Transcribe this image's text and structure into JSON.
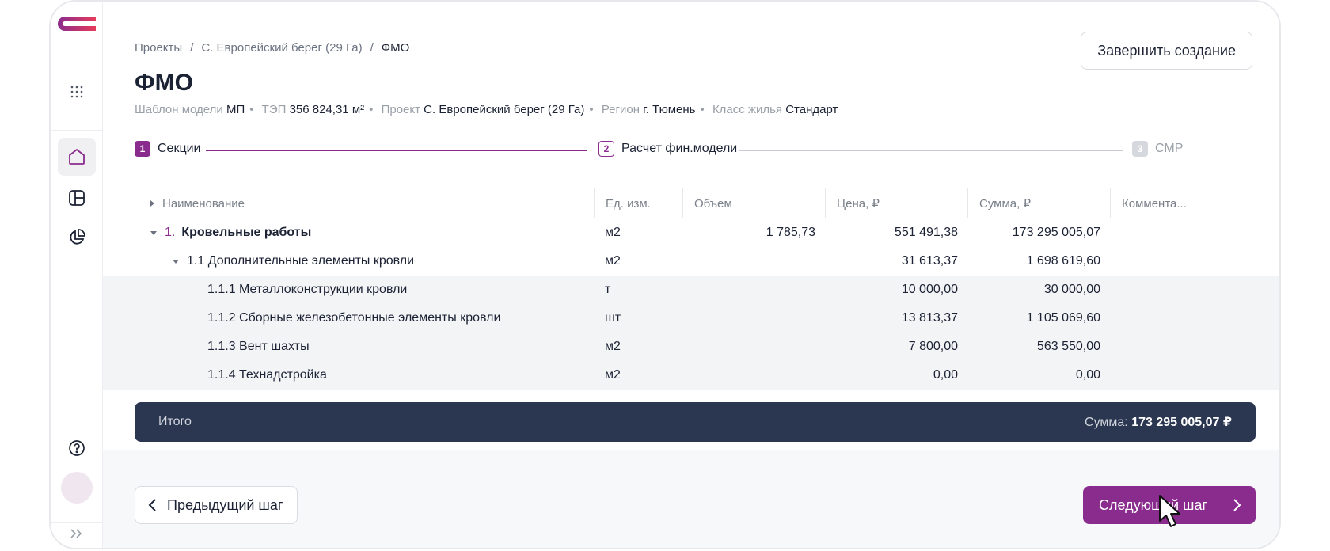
{
  "breadcrumb": [
    "Проекты",
    "С. Европейский берег (29 Га)",
    "ФМО"
  ],
  "breadcrumb_sep": "/",
  "finish_button": "Завершить создание",
  "page_title": "ФМО",
  "meta": [
    {
      "label": "Шаблон модели",
      "value": "МП"
    },
    {
      "label": "ТЭП",
      "value": "356 824,31 м²"
    },
    {
      "label": "Проект",
      "value": "С. Европейский берег (29 Га)"
    },
    {
      "label": "Регион",
      "value": "г. Тюмень"
    },
    {
      "label": "Класс жилья",
      "value": "Стандарт"
    }
  ],
  "steps": [
    {
      "num": "1",
      "label": "Секции",
      "state": "done"
    },
    {
      "num": "2",
      "label": "Расчет фин.модели",
      "state": "current"
    },
    {
      "num": "3",
      "label": "СМР",
      "state": "upcoming"
    }
  ],
  "table": {
    "columns": [
      "Наименование",
      "Ед. изм.",
      "Объем",
      "Цена, ₽",
      "Сумма, ₽",
      "Коммента..."
    ],
    "rows": [
      {
        "num": "1.",
        "name": "Кровельные работы",
        "unit": "м2",
        "volume": "1 785,73",
        "price": "551 491,38",
        "sum": "173 295 005,07",
        "level": 0
      },
      {
        "num": "",
        "name": "1.1 Дополнительные элементы кровли",
        "unit": "м2",
        "volume": "",
        "price": "31 613,37",
        "sum": "1 698 619,60",
        "level": 1
      },
      {
        "num": "",
        "name": "1.1.1 Металлоконструкции кровли",
        "unit": "т",
        "volume": "",
        "price": "10 000,00",
        "sum": "30 000,00",
        "level": 2
      },
      {
        "num": "",
        "name": "1.1.2 Сборные железобетонные элементы кровли",
        "unit": "шт",
        "volume": "",
        "price": "13 813,37",
        "sum": "1 105 069,60",
        "level": 2
      },
      {
        "num": "",
        "name": "1.1.3 Вент шахты",
        "unit": "м2",
        "volume": "",
        "price": "7 800,00",
        "sum": "563 550,00",
        "level": 2
      },
      {
        "num": "",
        "name": "1.1.4 Технадстройка",
        "unit": "м2",
        "volume": "",
        "price": "0,00",
        "sum": "0,00",
        "level": 2
      }
    ]
  },
  "total": {
    "label": "Итого",
    "sum_label": "Сумма:",
    "sum_value": "173 295 005,07 ₽"
  },
  "prev_button": "Предыдущий шаг",
  "next_button": "Следующий шаг",
  "colors": {
    "accent": "#8a2c8d",
    "total_bar": "#2b3651",
    "text": "#1b2234"
  },
  "icons": [
    "logo-icon",
    "apps-grid-icon",
    "home-icon",
    "layout-icon",
    "pie-chart-icon",
    "help-icon",
    "expand-sidebar-icon",
    "chevron-left-icon",
    "chevron-right-icon",
    "cursor-icon"
  ]
}
